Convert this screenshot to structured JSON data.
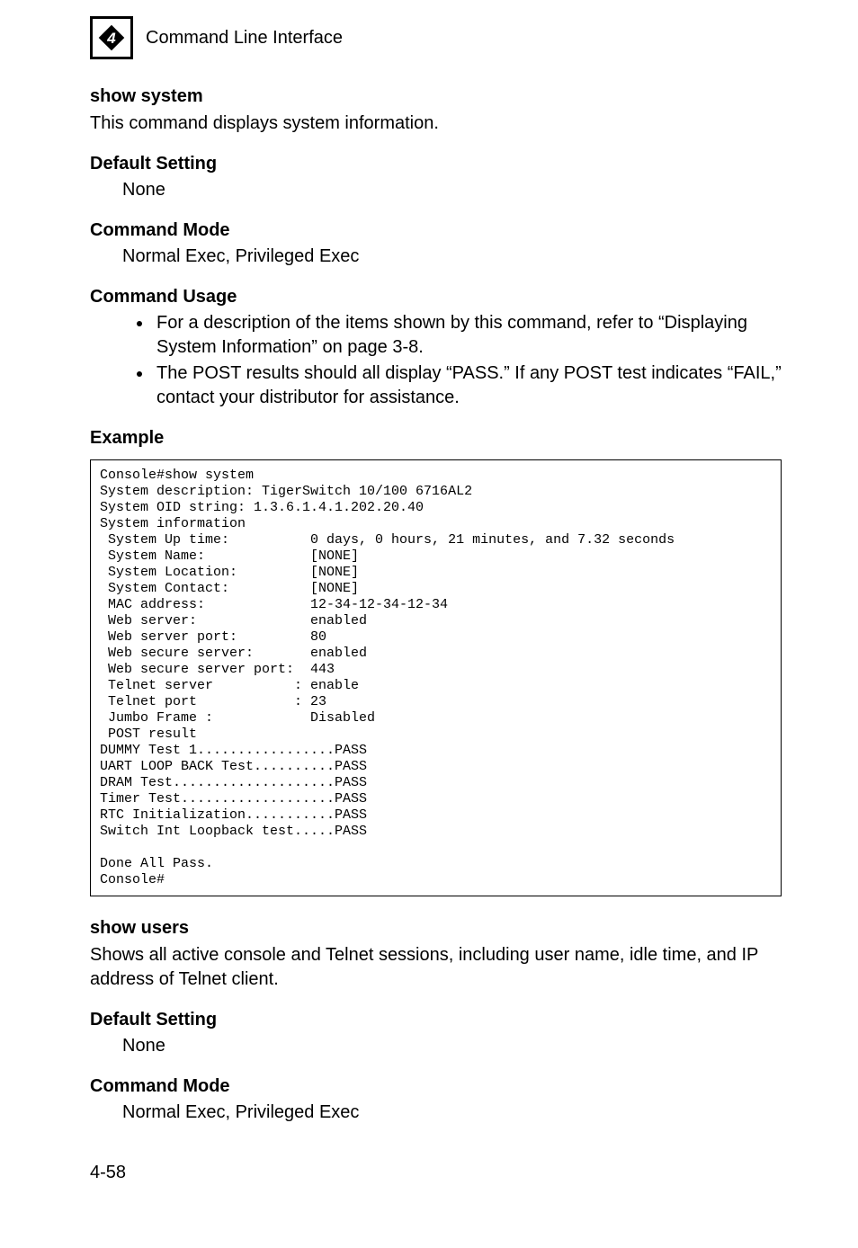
{
  "header": {
    "chapter_num": "4",
    "title": "Command Line Interface"
  },
  "section1": {
    "name": "show system",
    "desc": "This command displays system information.",
    "default_head": "Default Setting",
    "default_val": "None",
    "mode_head": "Command Mode",
    "mode_val": "Normal Exec, Privileged Exec",
    "usage_head": "Command Usage",
    "usage_b1": "For a description of the items shown by this command, refer to “Displaying System Information” on page 3-8.",
    "usage_b2": "The POST results should all display “PASS.” If any POST test indicates “FAIL,” contact your distributor for assistance.",
    "example_head": "Example",
    "code": "Console#show system\nSystem description: TigerSwitch 10/100 6716AL2\nSystem OID string: 1.3.6.1.4.1.202.20.40\nSystem information\n System Up time:          0 days, 0 hours, 21 minutes, and 7.32 seconds\n System Name:             [NONE]\n System Location:         [NONE]\n System Contact:          [NONE]\n MAC address:             12-34-12-34-12-34\n Web server:              enabled\n Web server port:         80\n Web secure server:       enabled\n Web secure server port:  443\n Telnet server          : enable\n Telnet port            : 23\n Jumbo Frame :            Disabled\n POST result\nDUMMY Test 1.................PASS\nUART LOOP BACK Test..........PASS\nDRAM Test....................PASS\nTimer Test...................PASS\nRTC Initialization...........PASS\nSwitch Int Loopback test.....PASS\n\nDone All Pass.\nConsole#"
  },
  "section2": {
    "name": "show users",
    "desc": "Shows all active console and Telnet sessions, including user name, idle time, and IP address of Telnet client.",
    "default_head": "Default Setting",
    "default_val": "None",
    "mode_head": "Command Mode",
    "mode_val": "Normal Exec, Privileged Exec"
  },
  "pagenum": "4-58"
}
